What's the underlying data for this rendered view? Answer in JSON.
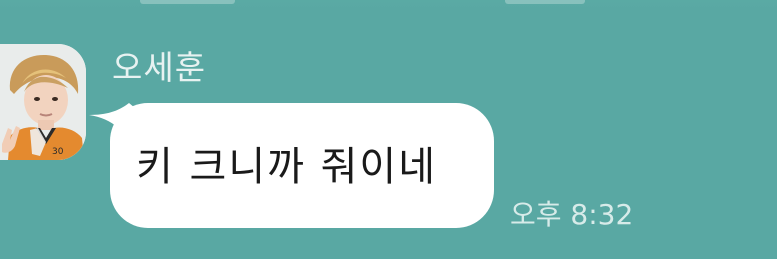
{
  "theme": {
    "background": "#59a8a3",
    "bubble": "#ffffff",
    "name_color": "#e7f2f1",
    "time_color": "#d7ebe9"
  },
  "message": {
    "sender": "오세훈",
    "text": "키 크니까 줘이네",
    "time": "오후 8:32",
    "avatar_icon": "profile-photo"
  }
}
